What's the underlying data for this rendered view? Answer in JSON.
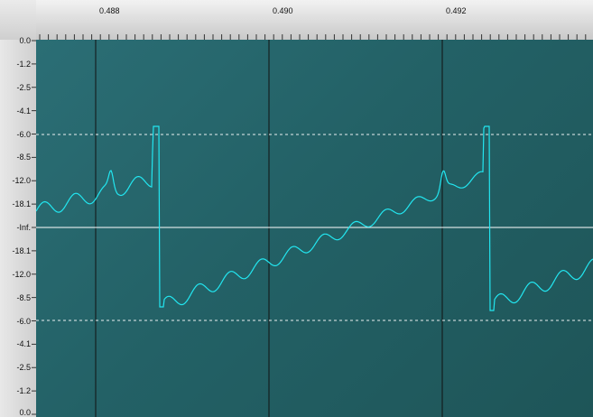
{
  "ruler": {
    "time_labels": [
      "0.488",
      "0.490",
      "0.492"
    ],
    "time_values": [
      0.488,
      0.49,
      0.492
    ]
  },
  "scale": {
    "db_labels": [
      "0.0",
      "-1.2",
      "-2.5",
      "-4.1",
      "-6.0",
      "-8.5",
      "-12.0",
      "-18.1",
      "-Inf.",
      "-18.1",
      "-12.0",
      "-8.5",
      "-6.0",
      "-4.1",
      "-2.5",
      "-1.2",
      "0.0"
    ],
    "half_wave_db_mark": "-6.0"
  },
  "waveform": {
    "color": "#22e6f0",
    "background": "#236166",
    "marker_line_color": "#000000",
    "center_line_color": "#ffffff",
    "guide_line_color": "#ffffff"
  }
}
